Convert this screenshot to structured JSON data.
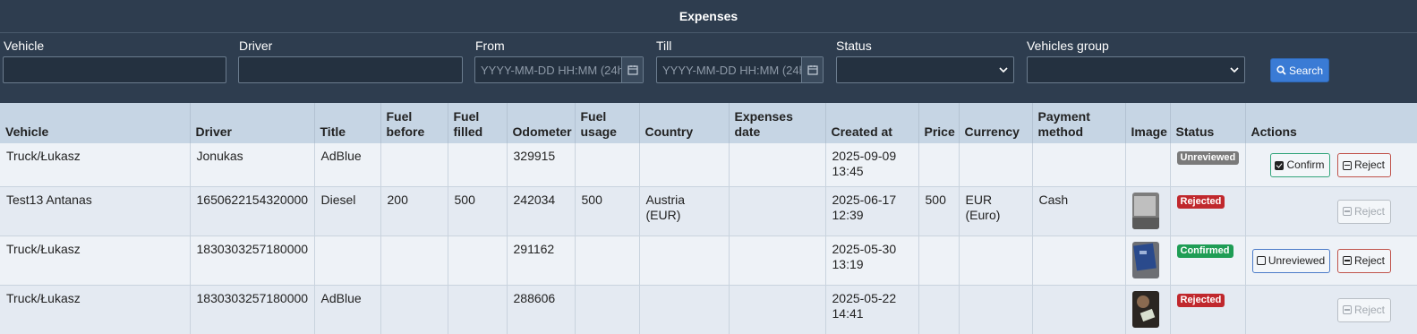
{
  "header": {
    "title": "Expenses"
  },
  "filters": {
    "vehicle_label": "Vehicle",
    "driver_label": "Driver",
    "from_label": "From",
    "from_placeholder": "YYYY-MM-DD HH:MM (24h)",
    "till_label": "Till",
    "till_placeholder": "YYYY-MM-DD HH:MM (24h)",
    "status_label": "Status",
    "group_label": "Vehicles group",
    "search_label": "Search"
  },
  "table": {
    "headers": {
      "vehicle": "Vehicle",
      "driver": "Driver",
      "title": "Title",
      "fuel_before": "Fuel before",
      "fuel_filled": "Fuel filled",
      "odometer": "Odometer",
      "fuel_usage": "Fuel usage",
      "country": "Country",
      "expenses_date": "Expenses date",
      "created_at": "Created at",
      "price": "Price",
      "currency": "Currency",
      "payment_method": "Payment method",
      "image": "Image",
      "status": "Status",
      "actions": "Actions"
    },
    "rows": [
      {
        "vehicle": "Truck/Łukasz",
        "driver": "Jonukas",
        "title": "AdBlue",
        "fuel_before": "",
        "fuel_filled": "",
        "odometer": "329915",
        "fuel_usage": "",
        "country": "",
        "expenses_date": "",
        "created_date": "2025-09-09",
        "created_time": "13:45",
        "price": "",
        "currency": "",
        "currency_detail": "",
        "payment_method": "",
        "status": "Unreviewed",
        "confirm_label": "Confirm",
        "reject_label": "Reject"
      },
      {
        "vehicle": "Test13 Antanas",
        "driver": "1650622154320000",
        "title": "Diesel",
        "fuel_before": "200",
        "fuel_filled": "500",
        "odometer": "242034",
        "fuel_usage": "500",
        "country": "Austria",
        "country_detail": "(EUR)",
        "expenses_date": "",
        "created_date": "2025-06-17",
        "created_time": "12:39",
        "price": "500",
        "currency": "EUR",
        "currency_detail": "(Euro)",
        "payment_method": "Cash",
        "status": "Rejected",
        "reject_label": "Reject"
      },
      {
        "vehicle": "Truck/Łukasz",
        "driver": "1830303257180000",
        "title": "",
        "fuel_before": "",
        "fuel_filled": "",
        "odometer": "291162",
        "fuel_usage": "",
        "country": "",
        "expenses_date": "",
        "created_date": "2025-05-30",
        "created_time": "13:19",
        "price": "",
        "currency": "",
        "currency_detail": "",
        "payment_method": "",
        "status": "Confirmed",
        "unreviewed_label": "Unreviewed",
        "reject_label": "Reject"
      },
      {
        "vehicle": "Truck/Łukasz",
        "driver": "1830303257180000",
        "title": "AdBlue",
        "fuel_before": "",
        "fuel_filled": "",
        "odometer": "288606",
        "fuel_usage": "",
        "country": "",
        "expenses_date": "",
        "created_date": "2025-05-22",
        "created_time": "14:41",
        "price": "",
        "currency": "",
        "currency_detail": "",
        "payment_method": "",
        "status": "Rejected",
        "reject_label": "Reject"
      }
    ]
  },
  "colors": {
    "header_bg": "#2e3d4f",
    "unreviewed": "#7a7a7a",
    "rejected": "#c0282d",
    "confirmed": "#1f9d55",
    "search": "#3a7bd5"
  }
}
